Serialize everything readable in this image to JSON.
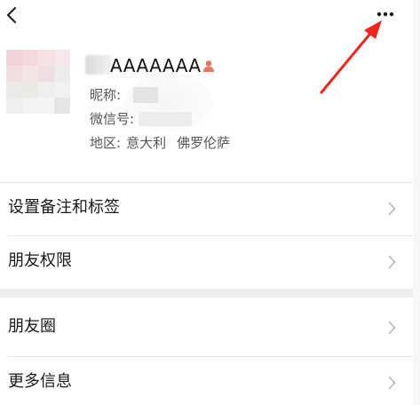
{
  "profile": {
    "display_name": "AAAAAAA",
    "nickname_label": "昵称:",
    "wechat_id_label": "微信号:",
    "region_label": "地区:",
    "region_country": "意大利",
    "region_city": "佛罗伦萨"
  },
  "menu": {
    "set_remark": "设置备注和标签",
    "friend_permissions": "朋友权限",
    "moments": "朋友圈",
    "more_info": "更多信息"
  },
  "colors": {
    "gender_icon": "#e8765a",
    "annotation_arrow": "#f2241c",
    "chevron": "#b3b3b3",
    "section_gap": "#ededed"
  },
  "icons": [
    "back-icon",
    "more-icon",
    "gender-icon",
    "chevron-right-icon"
  ]
}
